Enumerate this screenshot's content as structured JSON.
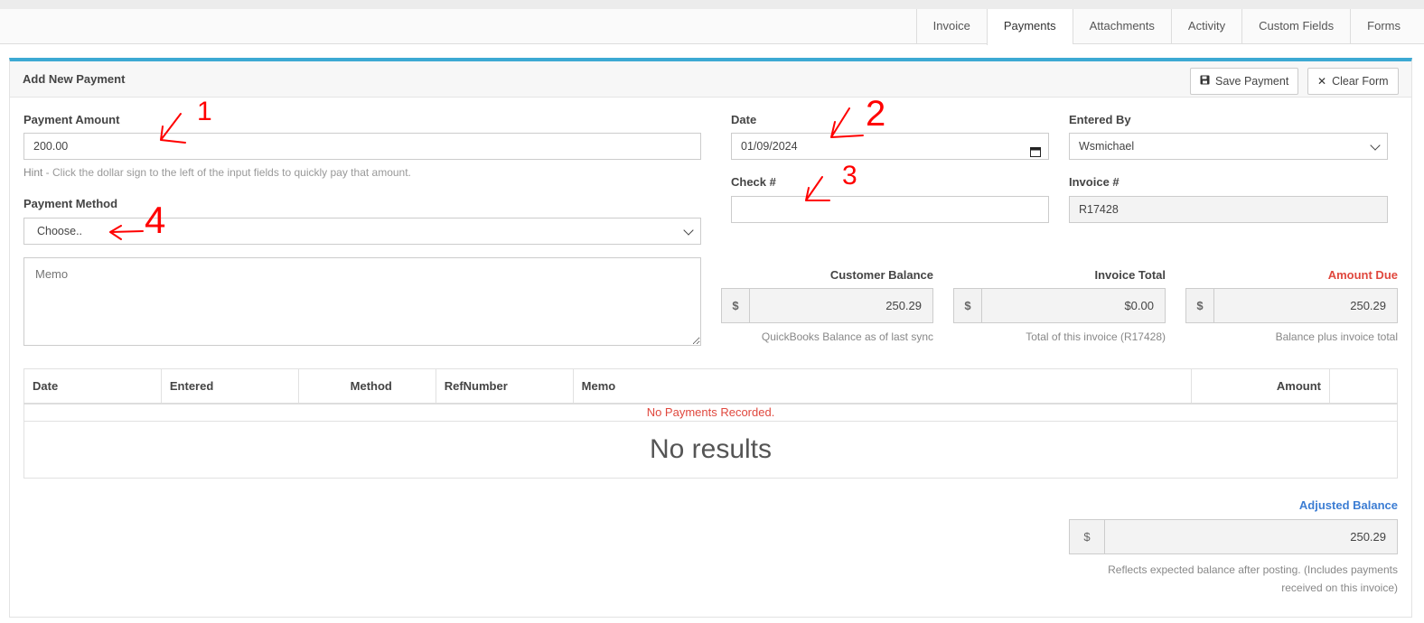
{
  "tabs": [
    {
      "label": "Invoice",
      "active": false
    },
    {
      "label": "Payments",
      "active": true
    },
    {
      "label": "Attachments",
      "active": false
    },
    {
      "label": "Activity",
      "active": false
    },
    {
      "label": "Custom Fields",
      "active": false
    },
    {
      "label": "Forms",
      "active": false
    }
  ],
  "panel": {
    "title": "Add New Payment",
    "save_label": "Save Payment",
    "clear_label": "Clear Form",
    "accent_color": "#3ca9d3"
  },
  "form": {
    "payment_amount_label": "Payment Amount",
    "payment_amount_value": "200.00",
    "hint_prefix": "Hint",
    "hint_text": " - Click the dollar sign to the left of the input fields to quickly pay that amount.",
    "payment_method_label": "Payment Method",
    "payment_method_value": "Choose..",
    "memo_placeholder": "Memo",
    "date_label": "Date",
    "date_value": "01/09/2024",
    "check_label": "Check #",
    "check_value": "",
    "entered_by_label": "Entered By",
    "entered_by_value": "Wsmichael",
    "invoice_label": "Invoice #",
    "invoice_value": "R17428"
  },
  "balances": {
    "currency_symbol": "$",
    "customer_balance_label": "Customer Balance",
    "customer_balance_value": "250.29",
    "customer_balance_note": "QuickBooks Balance as of last sync",
    "invoice_total_label": "Invoice Total",
    "invoice_total_value": "$0.00",
    "invoice_total_note": "Total of this invoice (R17428)",
    "amount_due_label": "Amount Due",
    "amount_due_value": "250.29",
    "amount_due_note": "Balance plus invoice total",
    "amount_due_color": "#e0483e"
  },
  "table": {
    "columns": [
      "Date",
      "Entered",
      "Method",
      "RefNumber",
      "Memo",
      "Amount",
      ""
    ],
    "empty_message": "No Payments Recorded.",
    "no_results": "No results"
  },
  "adjusted": {
    "label": "Adjusted Balance",
    "label_color": "#3c7dd3",
    "currency_symbol": "$",
    "value": "250.29",
    "note_line1": "Reflects expected balance after posting. (Includes payments",
    "note_line2": "received on this invoice)"
  },
  "annotations": {
    "color": "#ff0000",
    "marks": [
      "1",
      "2",
      "3",
      "4"
    ]
  },
  "icons": {
    "save": "floppy-disk-icon",
    "clear": "times-icon",
    "calendar": "calendar-icon"
  }
}
